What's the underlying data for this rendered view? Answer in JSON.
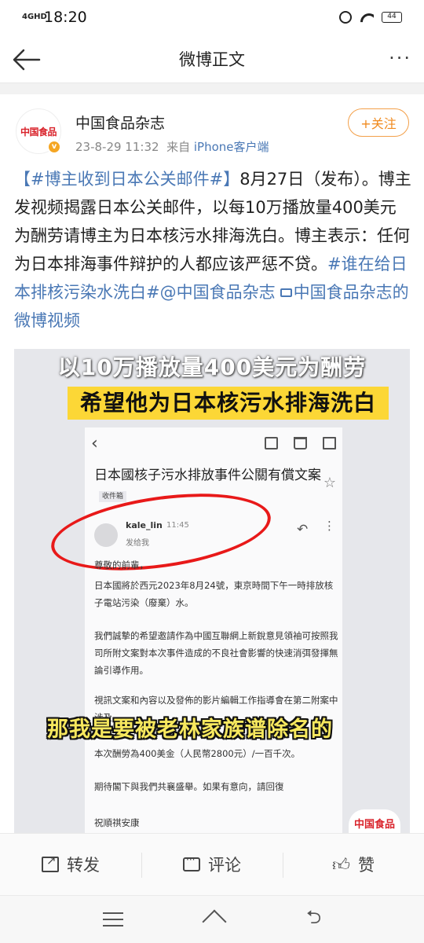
{
  "status_bar": {
    "network": "4GHD",
    "time": "18:20",
    "battery": "44"
  },
  "nav": {
    "title": "微博正文"
  },
  "post": {
    "avatar_text": "中国食品",
    "user_name": "中国食品杂志",
    "timestamp": "23-8-29 11:32",
    "source_prefix": "来自",
    "source": "iPhone客户端",
    "follow_label": "+关注",
    "text": {
      "hashtag1": "【#博主收到日本公关邮件#】",
      "body": "8月27日（发布）。博主发视频揭露日本公关邮件，以每10万播放量400美元为酬劳请博主为日本核污水排海洗白。博主表示：任何为日本排海事件辩护的人都应该严惩不贷。",
      "hashtag2": "#谁在给日本排核污染水洗白#",
      "mention": "@中国食品杂志",
      "video_link": "中国食品杂志的微博视频"
    }
  },
  "media": {
    "caption_top": "以10万播放量400美元为酬劳",
    "caption_highlight": "希望他为日本核污水排海洗白",
    "subtitle": "那我是要被老林家族谱除名的",
    "watermark": "中国食品",
    "email": {
      "subject": "日本國核子污水排放事件公關有償文案",
      "tag": "收件箱",
      "sender": "kale_lin",
      "time": "11:45",
      "to": "发给我",
      "lines": [
        "尊敬的前輩，",
        "日本國將於西元2023年8月24號，東京時間下午一時排放核子電站污染（廢棄）水。",
        "我們誠摯的希望邀請作為中國互聯網上新銳意見領袖可按照我司所附文案對本次事件造成的不良社會影響的快速消弭發揮無論引導作用。",
        "視訊文案和內容以及發佈的影片編輯工作指導會在第二附案中涉及",
        "本次酬勞為400美金（人民幣2800元）/一百千次。",
        "期待閣下與我們共襄盛舉。如果有意向，請回復",
        "祝順祺安康"
      ]
    }
  },
  "actions": {
    "repost": "转发",
    "comment": "评论",
    "like": "赞"
  }
}
